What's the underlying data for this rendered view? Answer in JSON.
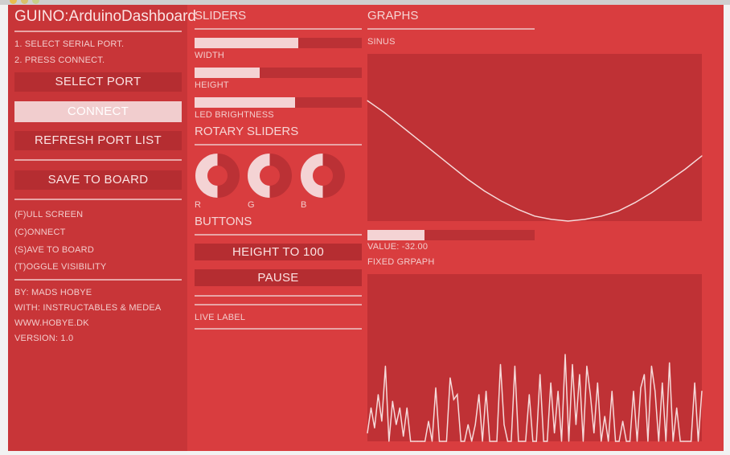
{
  "app": {
    "title": "GUINO:ArduinoDashboard"
  },
  "steps": [
    "1. SELECT SERIAL PORT.",
    "2. PRESS CONNECT."
  ],
  "left_buttons": {
    "select_port": "SELECT PORT",
    "connect": "CONNECT",
    "refresh": "REFRESH PORT LIST",
    "save": "SAVE TO BOARD"
  },
  "shortcuts": [
    "(F)ULL SCREEN",
    "(C)ONNECT",
    "(S)AVE TO BOARD",
    "(T)OGGLE VISIBILITY"
  ],
  "credits": [
    "BY: MADS HOBYE",
    "WITH: INSTRUCTABLES & MEDEA",
    "WWW.HOBYE.DK",
    "VERSION: 1.0"
  ],
  "sliders": {
    "heading": "SLIDERS",
    "items": [
      {
        "label": "WIDTH",
        "value": 0.62
      },
      {
        "label": "HEIGHT",
        "value": 0.39
      },
      {
        "label": "LED BRIGHTNESS",
        "value": 0.6
      }
    ]
  },
  "rotary": {
    "heading": "ROTARY SLIDERS",
    "items": [
      {
        "label": "R",
        "value": 0.5
      },
      {
        "label": "G",
        "value": 0.5
      },
      {
        "label": "B",
        "value": 0.5
      }
    ]
  },
  "buttons": {
    "heading": "BUTTONS",
    "height_to_100": "HEIGHT TO 100",
    "pause": "PAUSE",
    "live_label": "LIVE LABEL"
  },
  "graphs": {
    "heading": "GRAPHS",
    "sinus_label": "SINUS",
    "value_label": "VALUE: -32.00",
    "value_fraction": 0.34,
    "fixed_label": "FIXED GRPAPH"
  },
  "colors": {
    "background": "#d93d3f",
    "left_panel": "#c83538",
    "graph_panel": "#bf3135",
    "accent_light": "#f4d3d4"
  },
  "chart_data": [
    {
      "type": "line",
      "title": "SINUS",
      "x": [
        0,
        0.05,
        0.1,
        0.15,
        0.2,
        0.25,
        0.3,
        0.35,
        0.4,
        0.45,
        0.5,
        0.55,
        0.6,
        0.65,
        0.7,
        0.75,
        0.8,
        0.85,
        0.9,
        0.95,
        1
      ],
      "values": [
        0.72,
        0.65,
        0.57,
        0.49,
        0.41,
        0.33,
        0.25,
        0.18,
        0.12,
        0.07,
        0.03,
        0.01,
        0.0,
        0.01,
        0.03,
        0.06,
        0.11,
        0.17,
        0.24,
        0.31,
        0.39
      ],
      "ylim": [
        0,
        1
      ],
      "grid": false
    },
    {
      "type": "line",
      "title": "FIXED GRPAPH",
      "values": [
        0.05,
        0.2,
        0.08,
        0.28,
        0.12,
        0.45,
        0.0,
        0.24,
        0.1,
        0.2,
        0.03,
        0.2,
        0.0,
        0.0,
        0.0,
        0.0,
        0.0,
        0.12,
        0.0,
        0.32,
        0.0,
        0.0,
        0.0,
        0.38,
        0.25,
        0.28,
        0.0,
        0.0,
        0.1,
        0.0,
        0.1,
        0.28,
        0.0,
        0.3,
        0.0,
        0.0,
        0.0,
        0.46,
        0.1,
        0.0,
        0.0,
        0.45,
        0.0,
        0.0,
        0.0,
        0.28,
        0.0,
        0.0,
        0.4,
        0.0,
        0.0,
        0.35,
        0.05,
        0.3,
        0.0,
        0.52,
        0.0,
        0.46,
        0.1,
        0.4,
        0.0,
        0.45,
        0.28,
        0.05,
        0.35,
        0.0,
        0.15,
        0.0,
        0.3,
        0.0,
        0.0,
        0.12,
        0.0,
        0.0,
        0.3,
        0.0,
        0.32,
        0.4,
        0.0,
        0.45,
        0.3,
        0.0,
        0.35,
        0.0,
        0.47,
        0.0,
        0.2,
        0.0,
        0.0,
        0.0,
        0.0,
        0.35,
        0.0,
        0.3
      ],
      "ylim": [
        0,
        1
      ],
      "grid": false
    }
  ]
}
